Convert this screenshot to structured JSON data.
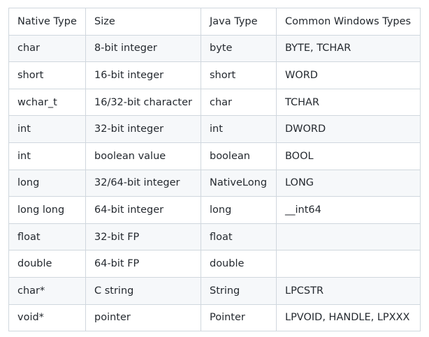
{
  "table": {
    "headers": [
      "Native Type",
      "Size",
      "Java Type",
      "Common Windows Types"
    ],
    "rows": [
      [
        "char",
        "8-bit integer",
        "byte",
        "BYTE, TCHAR"
      ],
      [
        "short",
        "16-bit integer",
        "short",
        "WORD"
      ],
      [
        "wchar_t",
        "16/32-bit character",
        "char",
        "TCHAR"
      ],
      [
        "int",
        "32-bit integer",
        "int",
        "DWORD"
      ],
      [
        "int",
        "boolean value",
        "boolean",
        "BOOL"
      ],
      [
        "long",
        "32/64-bit integer",
        "NativeLong",
        "LONG"
      ],
      [
        "long long",
        "64-bit integer",
        "long",
        "__int64"
      ],
      [
        "float",
        "32-bit FP",
        "float",
        ""
      ],
      [
        "double",
        "64-bit FP",
        "double",
        ""
      ],
      [
        "char*",
        "C string",
        "String",
        "LPCSTR"
      ],
      [
        "void*",
        "pointer",
        "Pointer",
        "LPVOID, HANDLE, LPXXX"
      ]
    ]
  }
}
